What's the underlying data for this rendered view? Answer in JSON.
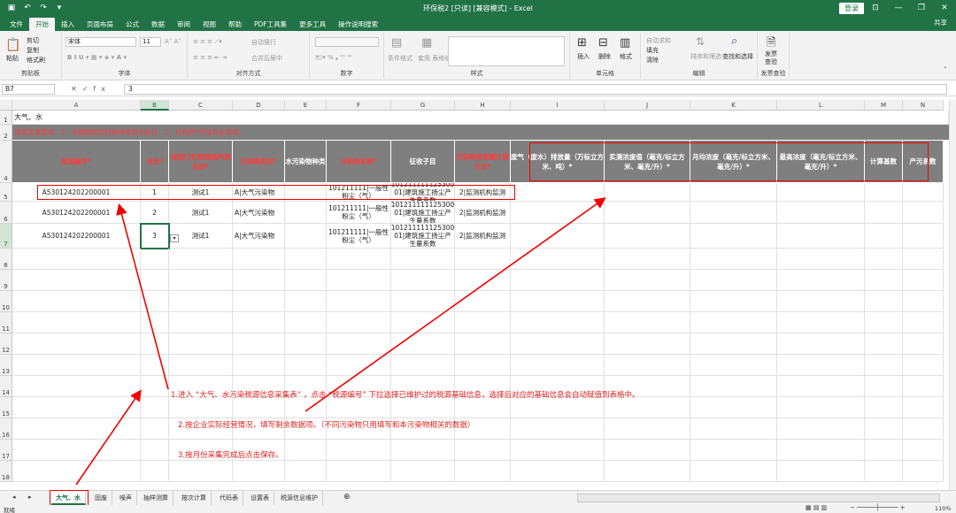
{
  "window": {
    "title": "环保税2  [只读]  [兼容模式]  -  Excel",
    "login_label": "登录",
    "share_label": "共享"
  },
  "ribbon_tabs": [
    "文件",
    "开始",
    "插入",
    "页面布局",
    "公式",
    "数据",
    "审阅",
    "视图",
    "帮助",
    "PDF工具集",
    "更多工具",
    "操作说明搜索"
  ],
  "ribbon": {
    "clipboard": {
      "paste": "粘贴",
      "cut": "剪切",
      "copy": "复制",
      "format_painter": "格式刷",
      "group": "剪贴板"
    },
    "font": {
      "name": "宋体",
      "size": "11",
      "group": "字体"
    },
    "alignment": {
      "wrap": "自动换行",
      "merge": "合并后居中",
      "group": "对齐方式"
    },
    "number": {
      "group": "数字"
    },
    "styles": {
      "cond_format": "条件格式",
      "table_format": "套用\n表格格式",
      "group": "样式"
    },
    "cells": {
      "insert": "插入",
      "delete": "删除",
      "format": "格式",
      "group": "单元格"
    },
    "editing": {
      "autosum": "自动求和",
      "fill": "填充",
      "clear": "清除",
      "sort": "排序和筛选",
      "find": "查找和选择",
      "group": "编辑"
    },
    "invoice": {
      "label": "发票\n查验",
      "group": "发票查验"
    }
  },
  "formula_bar": {
    "name_box": "B7",
    "fx": "fx",
    "value": "3"
  },
  "columns": [
    "A",
    "B",
    "C",
    "D",
    "E",
    "F",
    "G",
    "H",
    "I",
    "J",
    "K",
    "L",
    "M",
    "N"
  ],
  "selected_column": "B",
  "rows": [
    "1",
    "2",
    "4",
    "5",
    "6",
    "7",
    "8",
    "9",
    "10",
    "11",
    "12",
    "13",
    "14",
    "15",
    "16",
    "17",
    "18"
  ],
  "selected_row": "7",
  "sheet": {
    "row1": "大气、水",
    "notice": "请表注意事项，1、各数据项校验请参考表头批注，2、红色带*字段为必录项。",
    "headers": [
      {
        "text": "税源编号*",
        "red": true
      },
      {
        "text": "月份*",
        "red": true
      },
      {
        "text": "排放口名称或噪声源名称*",
        "red": true
      },
      {
        "text": "污染物类别*",
        "red": true
      },
      {
        "text": "水污染物种类",
        "red": false
      },
      {
        "text": "污染物名称*",
        "red": true
      },
      {
        "text": "征收子目",
        "red": false
      },
      {
        "text": "污染物排放量计算方法*",
        "red": true
      },
      {
        "text": "废气（废水）排放量（万标立方米、吨）*",
        "red": false
      },
      {
        "text": "实测浓度值（毫克/标立方米、毫克/升）*",
        "red": false
      },
      {
        "text": "月均浓度（毫克/标立方米、毫克/升）*",
        "red": false
      },
      {
        "text": "最高浓度（毫克/标立方米、毫克/升）*",
        "red": false
      },
      {
        "text": "计算基数",
        "red": false
      },
      {
        "text": "产污系数",
        "red": false
      }
    ],
    "data_rows": [
      {
        "tax_id": "A530124202200001",
        "month": "1",
        "outlet": "测试1",
        "category": "A|大气污染物",
        "name": "101211111|一般性粉尘（气）",
        "sub": "101211111125300 01|建筑施工扬尘产生量系数",
        "method": "2|监测机构监测"
      },
      {
        "tax_id": "A530124202200001",
        "month": "2",
        "outlet": "测试1",
        "category": "A|大气污染物",
        "name": "101211111|一般性粉尘（气）",
        "sub": "101211111125300 01|建筑施工扬尘产生量系数",
        "method": "2|监测机构监测"
      },
      {
        "tax_id": "A530124202200001",
        "month": "3",
        "outlet": "测试1",
        "category": "A|大气污染物",
        "name": "101211111|一般性粉尘（气）",
        "sub": "101211111125300 01|建筑施工扬尘产生量系数",
        "method": "2|监测机构监测"
      }
    ]
  },
  "instructions": [
    "1.进入 “大气、水污染税源信息采集表” ，点击 “税源编号” 下拉选择已维护过的税源基础信息，选择后对应的基础信息会自动赋值到表格中。",
    "2.按企业实际经营情况，填写剩余数据项。（不同污染物只用填写和本污染物相关的数据）",
    "3.按月份采集完成后点击保存。"
  ],
  "sheet_tabs": [
    "大气、水",
    "固废",
    "噪声",
    "抽样测算",
    "按次计算",
    "代码表",
    "设置表",
    "税源信息维护"
  ],
  "active_sheet": "大气、水",
  "status": {
    "left": "就绪",
    "zoom": "110%"
  }
}
